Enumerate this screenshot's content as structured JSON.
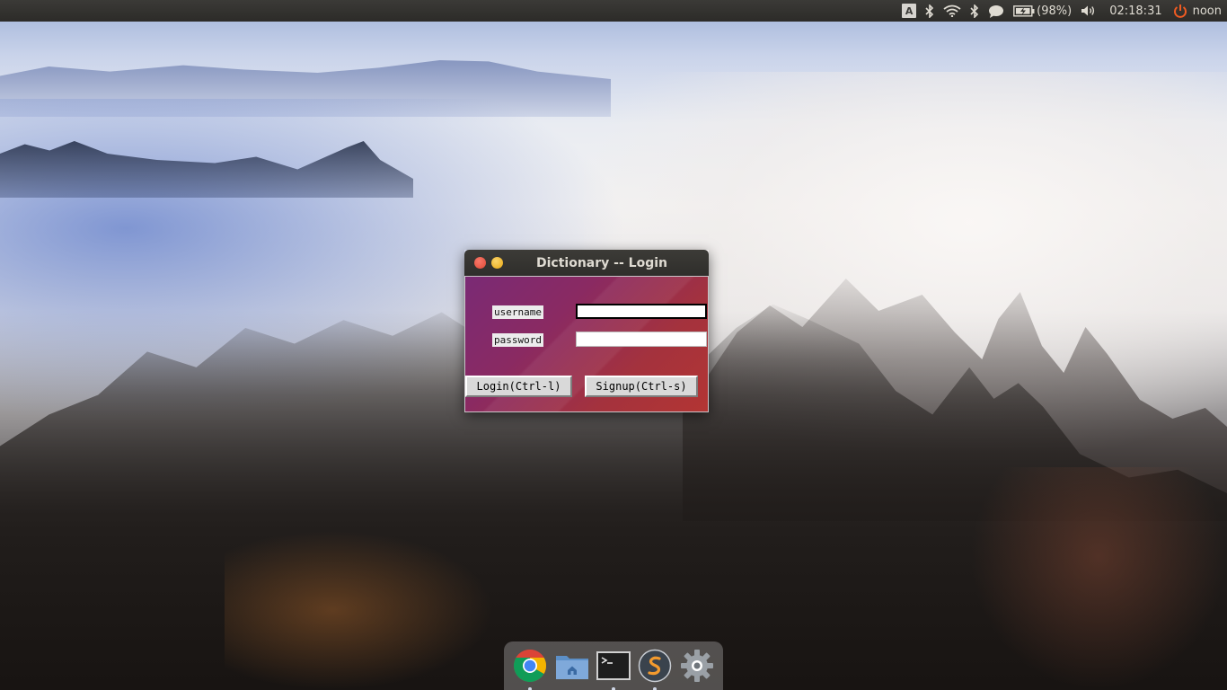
{
  "top_panel": {
    "keyboard_layout": "A",
    "battery_percent": "(98%)",
    "clock": "02:18:31",
    "user": "noon",
    "icons": [
      "keyboard-indicator-icon",
      "bluetooth-icon",
      "wifi-icon",
      "bluetooth-icon",
      "chat-bubble-icon",
      "battery-icon",
      "volume-icon",
      "power-icon"
    ]
  },
  "window": {
    "title": "Dictionary -- Login",
    "username_label": "username",
    "password_label": "password",
    "username_value": "",
    "password_value": "",
    "login_button": "Login(Ctrl-l)",
    "signup_button": "Signup(Ctrl-s)"
  },
  "dock": {
    "items": [
      "chrome-icon",
      "home-folder-icon",
      "terminal-icon",
      "sublime-text-icon",
      "settings-gear-icon"
    ]
  },
  "colors": {
    "panel_bg": "#2c2b28",
    "close_button": "#e04a36",
    "minimize_button": "#e8a813",
    "dialog_gradient_start": "#7a2a75",
    "dialog_gradient_end": "#b33533"
  }
}
